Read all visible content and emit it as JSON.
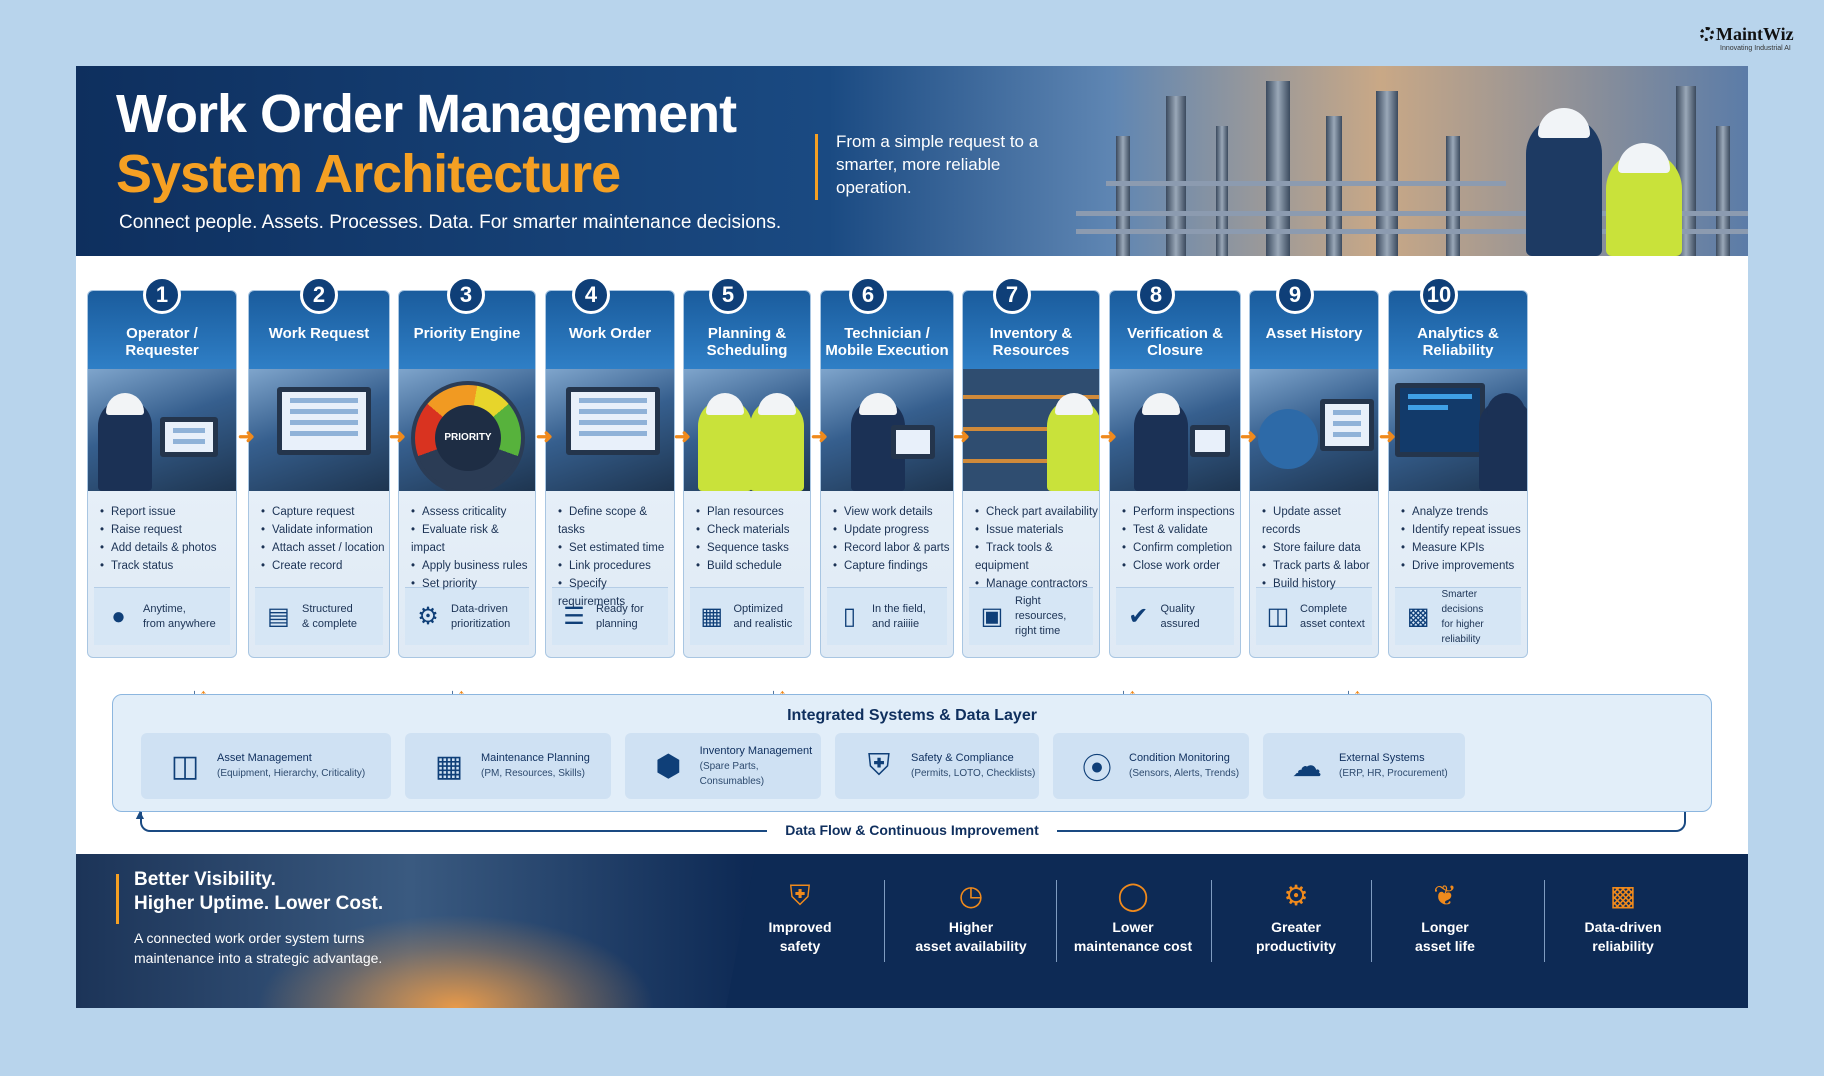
{
  "brand": {
    "name": "MaintWiz",
    "tagline": "Innovating Industrial AI"
  },
  "hero": {
    "title_line1": "Work Order Management",
    "title_line2": "System Architecture",
    "tagline": "Connect people. Assets. Processes. Data. For smarter maintenance decisions.",
    "quote": "From a simple request to a smarter, more reliable operation."
  },
  "steps": [
    {
      "num": "1",
      "title": "Operator / Requester",
      "bullets": [
        "Report issue",
        "Raise request",
        "Add details & photos",
        "Track status"
      ],
      "footer": "Anytime,\nfrom anywhere",
      "icon": "person-icon"
    },
    {
      "num": "2",
      "title": "Work Request",
      "bullets": [
        "Capture request",
        "Validate information",
        "Attach asset / location",
        "Create record"
      ],
      "footer": "Structured\n& complete",
      "icon": "document-icon"
    },
    {
      "num": "3",
      "title": "Priority Engine",
      "bullets": [
        "Assess criticality",
        "Evaluate risk & impact",
        "Apply business rules",
        "Set priority"
      ],
      "footer": "Data-driven\nprioritization",
      "icon": "gear-icon",
      "image_label": "PRIORITY"
    },
    {
      "num": "4",
      "title": "Work Order",
      "bullets": [
        "Define scope & tasks",
        "Set estimated time",
        "Link procedures",
        "Specify requirements"
      ],
      "footer": "Ready for\nplanning",
      "icon": "checklist-icon"
    },
    {
      "num": "5",
      "title": "Planning & Scheduling",
      "bullets": [
        "Plan resources",
        "Check materials",
        "Sequence tasks",
        "Build schedule"
      ],
      "footer": "Optimized\nand realistic",
      "icon": "calendar-icon"
    },
    {
      "num": "6",
      "title": "Technician / Mobile Execution",
      "bullets": [
        "View work details",
        "Update progress",
        "Record labor & parts",
        "Capture findings"
      ],
      "footer": "In the field,\nand raiiiie",
      "icon": "mobile-icon"
    },
    {
      "num": "7",
      "title": "Inventory & Resources",
      "bullets": [
        "Check part availability",
        "Issue materials",
        "Track tools & equipment",
        "Manage contractors"
      ],
      "footer": "Right resources,\nright time",
      "icon": "box-icon"
    },
    {
      "num": "8",
      "title": "Verification & Closure",
      "bullets": [
        "Perform inspections",
        "Test & validate",
        "Confirm completion",
        "Close work order"
      ],
      "footer": "Quality\nassured",
      "icon": "check-circle-icon"
    },
    {
      "num": "9",
      "title": "Asset History",
      "bullets": [
        "Update asset records",
        "Store failure data",
        "Track parts & labor",
        "Build history"
      ],
      "footer": "Complete\nasset context",
      "icon": "database-icon"
    },
    {
      "num": "10",
      "title": "Analytics & Reliability",
      "bullets": [
        "Analyze trends",
        "Identify repeat issues",
        "Measure KPIs",
        "Drive improvements"
      ],
      "footer": "Smarter decisions\nfor higher reliability",
      "icon": "bar-chart-icon"
    }
  ],
  "data_layer": {
    "title": "Integrated Systems & Data Layer",
    "systems": [
      {
        "name": "Asset Management",
        "detail": "(Equipment, Hierarchy, Criticality)",
        "icon": "database-icon"
      },
      {
        "name": "Maintenance Planning",
        "detail": "(PM, Resources, Skills)",
        "icon": "calendar-icon"
      },
      {
        "name": "Inventory Management",
        "detail": "(Spare Parts, Consumables)",
        "icon": "cube-icon"
      },
      {
        "name": "Safety & Compliance",
        "detail": "(Permits, LOTO, Checklists)",
        "icon": "shield-check-icon"
      },
      {
        "name": "Condition Monitoring",
        "detail": "(Sensors, Alerts, Trends)",
        "icon": "signal-icon"
      },
      {
        "name": "External Systems",
        "detail": "(ERP, HR, Procurement)",
        "icon": "cloud-icon"
      }
    ],
    "flow_label": "Data Flow & Continuous Improvement"
  },
  "footer": {
    "headline_line1": "Better Visibility.",
    "headline_line2": "Higher Uptime. Lower Cost.",
    "text_line1": "A connected work order system turns",
    "text_line2": "maintenance into a strategic advantage.",
    "benefits": [
      {
        "line1": "Improved",
        "line2": "safety",
        "icon": "shield-icon"
      },
      {
        "line1": "Higher",
        "line2": "asset availability",
        "icon": "clock-icon"
      },
      {
        "line1": "Lower",
        "line2": "maintenance cost",
        "icon": "coins-icon"
      },
      {
        "line1": "Greater",
        "line2": "productivity",
        "icon": "gear-icon"
      },
      {
        "line1": "Longer",
        "line2": "asset life",
        "icon": "leaf-icon"
      },
      {
        "line1": "Data-driven",
        "line2": "reliability",
        "icon": "growth-chart-icon"
      }
    ]
  },
  "colors": {
    "navy": "#0f3f78",
    "accent": "#f5a023",
    "background": "#b8d4ec"
  }
}
